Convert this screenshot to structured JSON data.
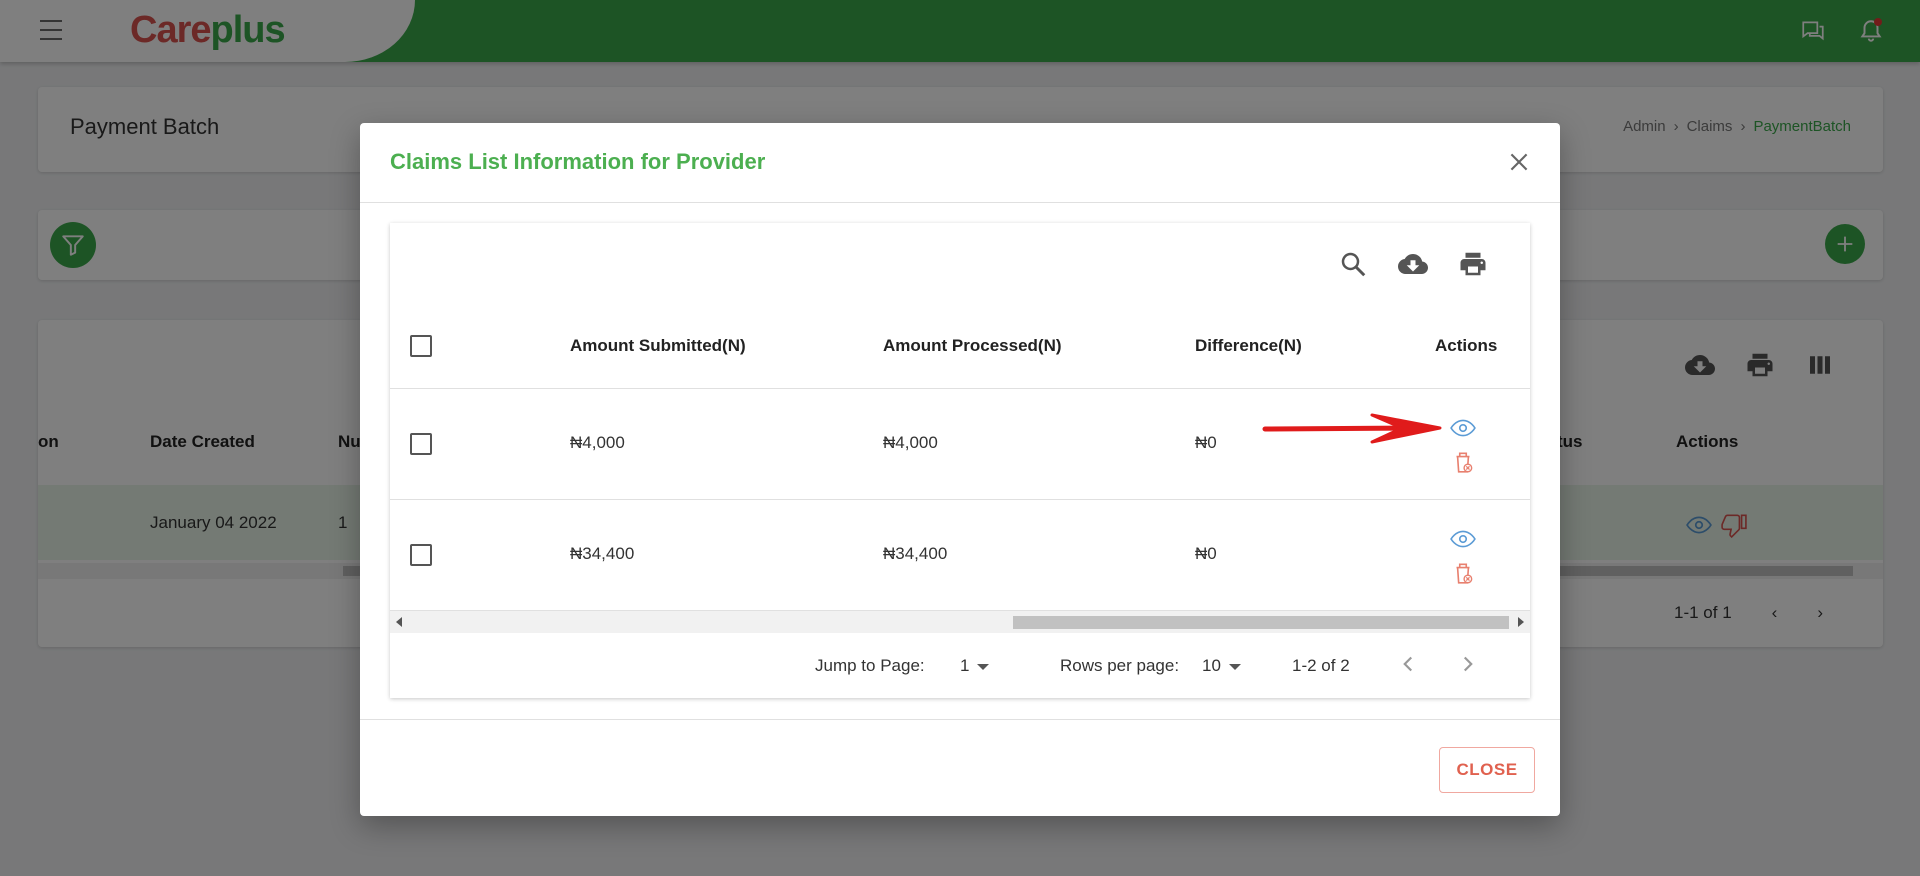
{
  "header": {
    "logo_part1": "Care",
    "logo_part2": "plus",
    "icons": [
      "menu-icon",
      "chat-icon",
      "bell-icon"
    ]
  },
  "page": {
    "title": "Payment Batch",
    "breadcrumb": [
      "Admin",
      "Claims",
      "PaymentBatch"
    ],
    "table_headers": [
      "on",
      "Date Created",
      "Nu",
      "tus",
      "Actions"
    ],
    "row": {
      "date_created": "January 04 2022",
      "number": "1"
    },
    "pagination": "1-1 of 1"
  },
  "modal": {
    "title": "Claims List Information for Provider",
    "toolbar_icons": [
      "search-icon",
      "download-icon",
      "print-icon"
    ],
    "columns": [
      "Amount Submitted(N)",
      "Amount Processed(N)",
      "Difference(N)",
      "Actions"
    ],
    "rows": [
      {
        "amount_submitted": "₦4,000",
        "amount_processed": "₦4,000",
        "difference": "₦0"
      },
      {
        "amount_submitted": "₦34,400",
        "amount_processed": "₦34,400",
        "difference": "₦0"
      }
    ],
    "pagination": {
      "jump_label": "Jump to Page:",
      "jump_value": "1",
      "rows_label": "Rows per page:",
      "rows_value": "10",
      "range": "1-2 of 2"
    },
    "close_label": "CLOSE"
  },
  "colors": {
    "brand_green": "#3aa84a",
    "title_green": "#4caf50",
    "view_icon": "#5b9bd5",
    "delete_icon": "#e8806f",
    "annotation_arrow": "#e01b1b"
  }
}
